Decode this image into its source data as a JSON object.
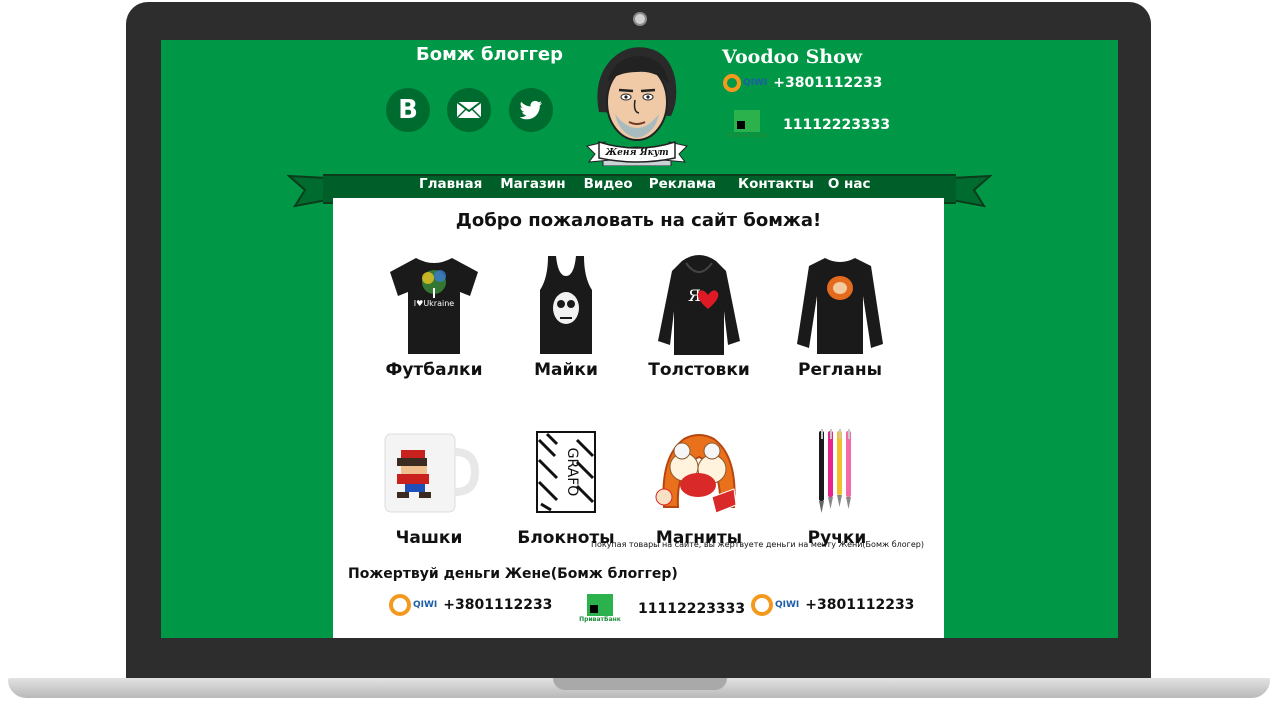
{
  "header": {
    "site_title": "Бомж блоггер",
    "show_title": "Voodoo Show",
    "avatar_caption": "Женя Якут",
    "social": [
      {
        "name": "vk",
        "icon": "vk-icon",
        "glyph": "B"
      },
      {
        "name": "mail",
        "icon": "mail-icon"
      },
      {
        "name": "twitter",
        "icon": "twitter-icon"
      }
    ],
    "qiwi_label": "QIWI",
    "qiwi_number": "+3801112233",
    "privat_label": "ПриватБанк",
    "privat_number": "11112223333"
  },
  "nav": {
    "items": [
      "Главная",
      "Магазин",
      "Видео",
      "Реклама",
      "Контакты",
      "О нас"
    ]
  },
  "main": {
    "welcome": "Добро пожаловать на сайт бомжа!",
    "products": [
      {
        "label": "Футбалки",
        "icon": "tshirt-icon"
      },
      {
        "label": "Майки",
        "icon": "tanktop-icon"
      },
      {
        "label": "Толстовки",
        "icon": "hoodie-icon"
      },
      {
        "label": "Регланы",
        "icon": "longsleeve-icon"
      },
      {
        "label": "Чашки",
        "icon": "mug-icon"
      },
      {
        "label": "Блокноты",
        "icon": "notebook-icon"
      },
      {
        "label": "Магниты",
        "icon": "magnet-icon"
      },
      {
        "label": "Ручки",
        "icon": "pens-icon"
      }
    ],
    "tshirt_print": "I♥Ukraine",
    "hoodie_print": "Я",
    "notebook_print": "GRAFO",
    "note": "Покупая товары на сайте, вы жертвуете деньги на мечту Жени(Бомж блогер)",
    "donate_title": "Пожертвуй деньги Жене(Бомж блоггер)",
    "payments": [
      {
        "type": "qiwi",
        "label": "QIWI",
        "value": "+3801112233"
      },
      {
        "type": "privat",
        "label": "ПриватБанк",
        "value": "11112223333"
      },
      {
        "type": "qiwi",
        "label": "QIWI",
        "value": "+3801112233"
      }
    ]
  },
  "colors": {
    "background": "#009846",
    "ribbon": "#005f28",
    "social_circle": "#006b2e",
    "qiwi_orange": "#f39a1e",
    "privat_green": "#2bb24c"
  }
}
